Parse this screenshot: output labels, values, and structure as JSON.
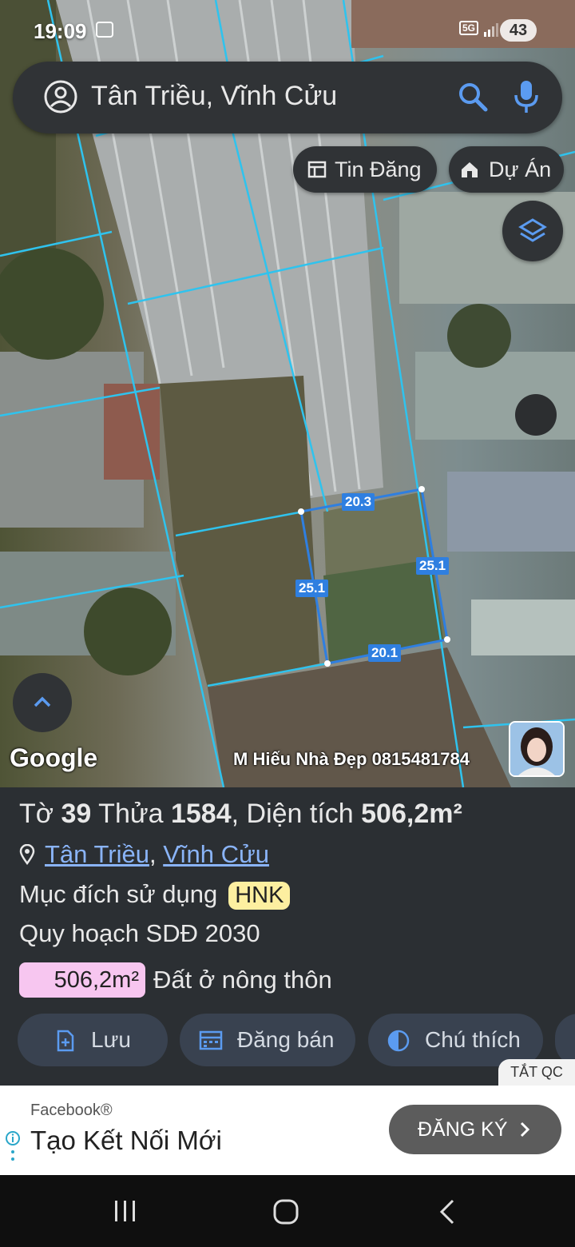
{
  "status_bar": {
    "time": "19:09",
    "network": "5G",
    "battery": "43"
  },
  "search": {
    "text": "Tân Triều, Vĩnh Cửu"
  },
  "chips": {
    "tin_dang": "Tin Đăng",
    "du_an": "Dự Án"
  },
  "map": {
    "google_label": "Google",
    "agent_label": "M Hiếu Nhà Đẹp 0815481784",
    "measurements": {
      "top": "20.3",
      "left": "25.1",
      "right": "25.1",
      "bottom": "20.1"
    }
  },
  "parcel": {
    "sheet_prefix": "Tờ ",
    "sheet_no": "39",
    "plot_prefix": " Thửa ",
    "plot_no": "1584",
    "area_prefix": ", Diện tích ",
    "area": "506,2m²",
    "commune": "Tân Triều",
    "separator": ",",
    "district": "Vĩnh Cửu",
    "purpose_label": "Mục đích sử dụng",
    "purpose_code": "HNK",
    "plan_label": "Quy hoạch SDĐ 2030",
    "plan_area": "506,2m²",
    "plan_type": "Đất ở nông thôn"
  },
  "actions": {
    "save": "Lưu",
    "post_sale": "Đăng bán",
    "legend": "Chú thích"
  },
  "ad": {
    "close_label": "TẮT QC",
    "source": "Facebook®",
    "title": "Tạo Kết Nối Mới",
    "cta": "ĐĂNG KÝ"
  },
  "colors": {
    "parcel_line": "#2f7fe0",
    "hnk_badge": "#fdefa0",
    "area_badge": "#f7c6f0",
    "link": "#8ab4f8"
  }
}
